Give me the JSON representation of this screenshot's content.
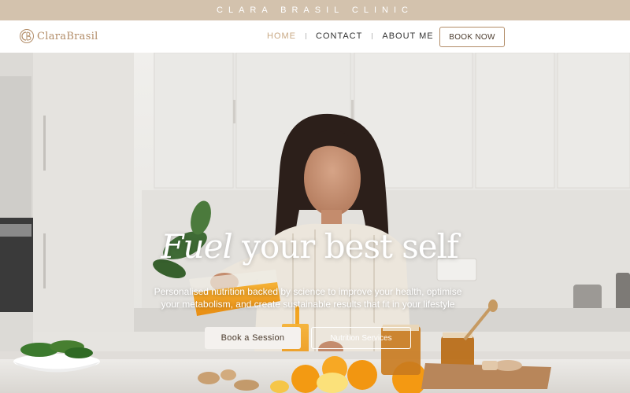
{
  "announcement": {
    "text": "CLARA BRASIL CLINIC"
  },
  "brand": {
    "logo_name": "ClaraBrasil",
    "logo_monogram_icon": "cb-monogram-icon"
  },
  "nav": {
    "items": [
      {
        "label": "HOME",
        "active": true
      },
      {
        "label": "CONTACT",
        "active": false
      },
      {
        "label": "ABOUT ME",
        "active": false
      }
    ],
    "book_label": "BOOK NOW"
  },
  "hero": {
    "headline_italic": "Fuel",
    "headline_rest": " your best self",
    "subtext_line1": "Personalised nutrition backed by science to improve your health, optimise",
    "subtext_line2": "your metabolism, and create sustainable results that fit in your lifestyle",
    "primary_cta": "Book a Session",
    "secondary_cta": "Nutrition Services"
  },
  "colors": {
    "accent": "#b28c67",
    "topbar": "#d3c2ad",
    "nav_active": "#c8a884"
  }
}
